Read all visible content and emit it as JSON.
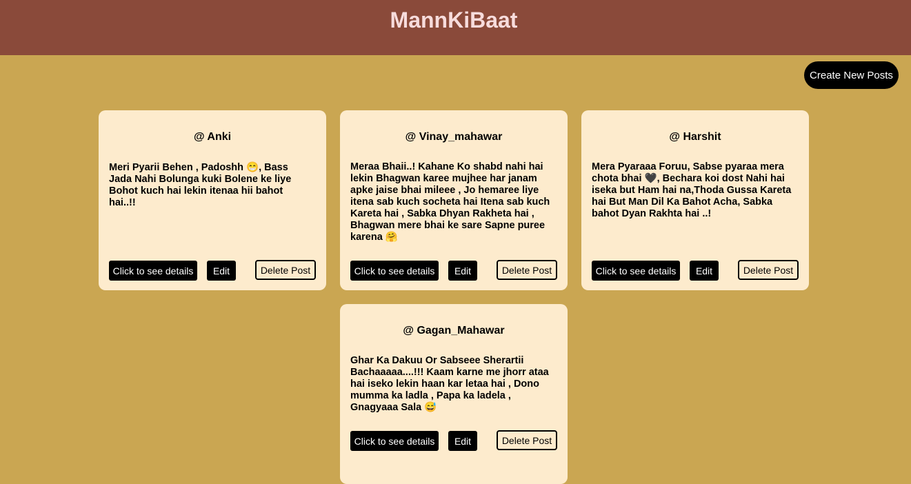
{
  "header": {
    "title": "MannKiBaat",
    "background": "#8a4a3a"
  },
  "actions": {
    "create_label": "Create New Posts"
  },
  "buttons": {
    "details_label": "Click to see details",
    "edit_label": "Edit",
    "delete_label": "Delete Post"
  },
  "colors": {
    "page_background": "#caa652",
    "card_background": "#fdebcd",
    "button_dark": "#000000"
  },
  "posts": [
    {
      "author": "@ Anki",
      "body": "Meri Pyarii Behen , Padoshh 😁, Bass Jada Nahi Bolunga kuki Bolene ke liye Bohot kuch hai lekin itenaa hii bahot hai..!!"
    },
    {
      "author": "@ Vinay_mahawar",
      "body": "Meraa Bhaii..! Kahane Ko shabd nahi hai lekin Bhagwan karee mujhee har janam apke jaise bhai mileee , Jo hemaree liye itena sab kuch socheta hai Itena sab kuch Kareta hai , Sabka Dhyan Rakheta hai , Bhagwan mere bhai ke sare Sapne puree karena 🤗"
    },
    {
      "author": "@ Harshit",
      "body": "Mera Pyaraaa Foruu, Sabse pyaraa mera chota bhai 🖤, Bechara koi dost Nahi hai iseka but Ham hai na,Thoda Gussa Kareta hai But Man Dil Ka Bahot Acha, Sabka bahot Dyan Rakhta hai ..!"
    },
    {
      "author": "@ Gagan_Mahawar",
      "body": "Ghar Ka Dakuu Or Sabseee Sherartii Bachaaaaa....!!! Kaam karne me jhorr ataa hai iseko lekin haan kar letaa hai , Dono mumma ka ladla , Papa ka ladela , Gnagyaaa Sala 😅"
    }
  ]
}
